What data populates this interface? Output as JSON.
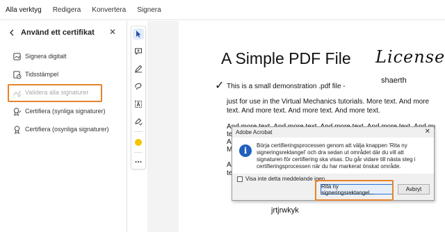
{
  "menu": [
    "Alla verktyg",
    "Redigera",
    "Konvertera",
    "Signera"
  ],
  "panel": {
    "title": "Använd ett certifikat",
    "items": [
      {
        "label": "Signera digitalt",
        "icon": "sign-digital-icon",
        "disabled": false
      },
      {
        "label": "Tidsstämpel",
        "icon": "timestamp-icon",
        "disabled": false
      },
      {
        "label": "Validera alla signaturer",
        "icon": "validate-signatures-icon",
        "disabled": true
      },
      {
        "label": "Certifiera (synliga signaturer)",
        "icon": "certify-visible-icon",
        "disabled": false
      },
      {
        "label": "Certifiera (osynliga signaturer)",
        "icon": "certify-invisible-icon",
        "disabled": false
      }
    ]
  },
  "tools": [
    "select-arrow-icon",
    "add-comment-icon",
    "highlight-pen-icon",
    "draw-freeform-icon",
    "text-box-icon",
    "stamp-sign-icon",
    "color-dot-icon",
    "more-icon"
  ],
  "document": {
    "title": "A Simple PDF File",
    "signature": "License",
    "signer": "shaerth",
    "line1": "This is a small demonstration .pdf file -",
    "para1": "just for use in the Virtual Mechanics tutorials. More text. And more text. And more text. And more text. And more text.",
    "para2_line": "And more text. And more text. And more text. And more text. And more",
    "clipped_lines": [
      "te",
      "A",
      "M"
    ],
    "clipped_lines2": [
      "A",
      "te"
    ],
    "bottom_text": "jrtjrwkyk"
  },
  "dialog": {
    "title": "Adobe Acrobat",
    "message": "Börja certifieringsprocessen genom att välja knappen 'Rita ny signeringsrektangel' och dra sedan ut området där du vill att signaturen för certifiering ska visas. Du går vidare till nästa steg i certifieringsprocessen när du har markerat önskat område.",
    "checkbox_label": "Visa inte detta meddelande igen",
    "primary_button": "Rita ny signeringsrektangel...",
    "cancel_button": "Avbryt"
  },
  "colors": {
    "highlight": "#e8822a",
    "accent": "#1f5fbf"
  }
}
